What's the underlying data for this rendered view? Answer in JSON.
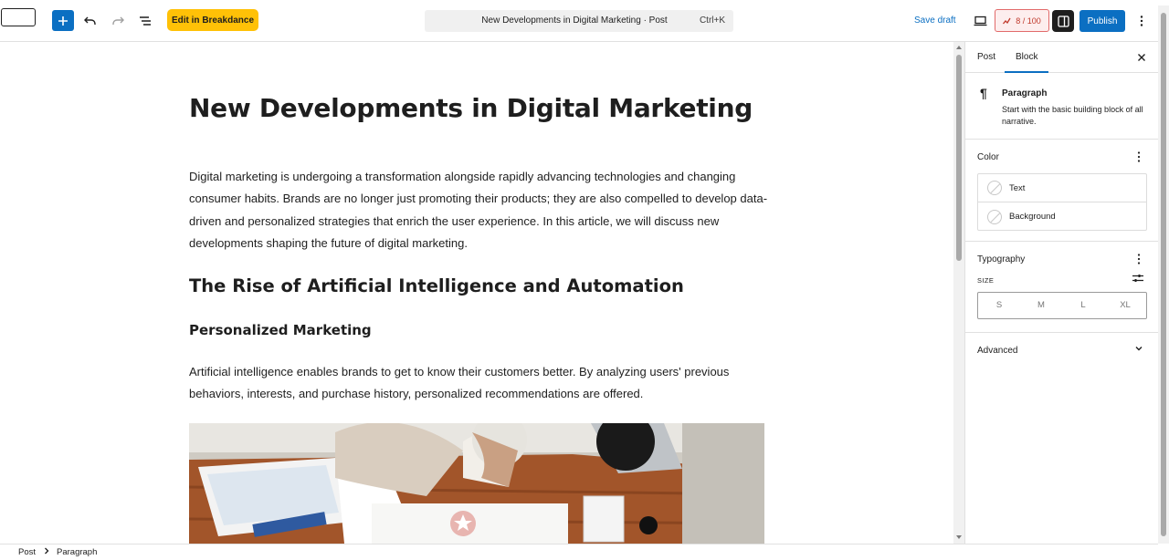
{
  "toolbar": {
    "breakdance_label": "Edit in Breakdance",
    "command_title": "New Developments in Digital Marketing · Post",
    "command_shortcut": "Ctrl+K",
    "save_draft_label": "Save draft",
    "seo_score": "8 / 100",
    "publish_label": "Publish",
    "icons": [
      "add-block-icon",
      "undo-icon",
      "redo-icon",
      "list-view-icon",
      "desktop-preview-icon",
      "seo-chart-icon",
      "sidebar-toggle-icon",
      "more-options-icon"
    ]
  },
  "post": {
    "title": "New Developments in Digital Marketing",
    "intro": "Digital marketing is undergoing a transformation alongside rapidly advancing technologies and changing consumer habits. Brands are no longer just promoting their products; they are also compelled to develop data-driven and personalized strategies that enrich the user experience. In this article, we will discuss new developments shaping the future of digital marketing.",
    "heading2": "The Rise of Artificial Intelligence and Automation",
    "heading3": "Personalized Marketing",
    "paragraph2": "Artificial intelligence enables brands to get to know their customers better. By analyzing users' previous behaviors, interests, and purchase history, personalized recommendations are offered."
  },
  "sidebar": {
    "tab_post": "Post",
    "tab_block": "Block",
    "block_name": "Paragraph",
    "block_description": "Start with the basic building block of all narrative.",
    "color_title": "Color",
    "color_text": "Text",
    "color_background": "Background",
    "typography_title": "Typography",
    "size_label": "SIZE",
    "sizes": [
      "S",
      "M",
      "L",
      "XL"
    ],
    "advanced_title": "Advanced"
  },
  "breadcrumb": {
    "items": [
      "Post",
      "Paragraph"
    ]
  },
  "colors": {
    "primary_blue": "#0b6fc2",
    "breakdance_yellow": "#ffc107",
    "seo_red": "#c0392b"
  }
}
